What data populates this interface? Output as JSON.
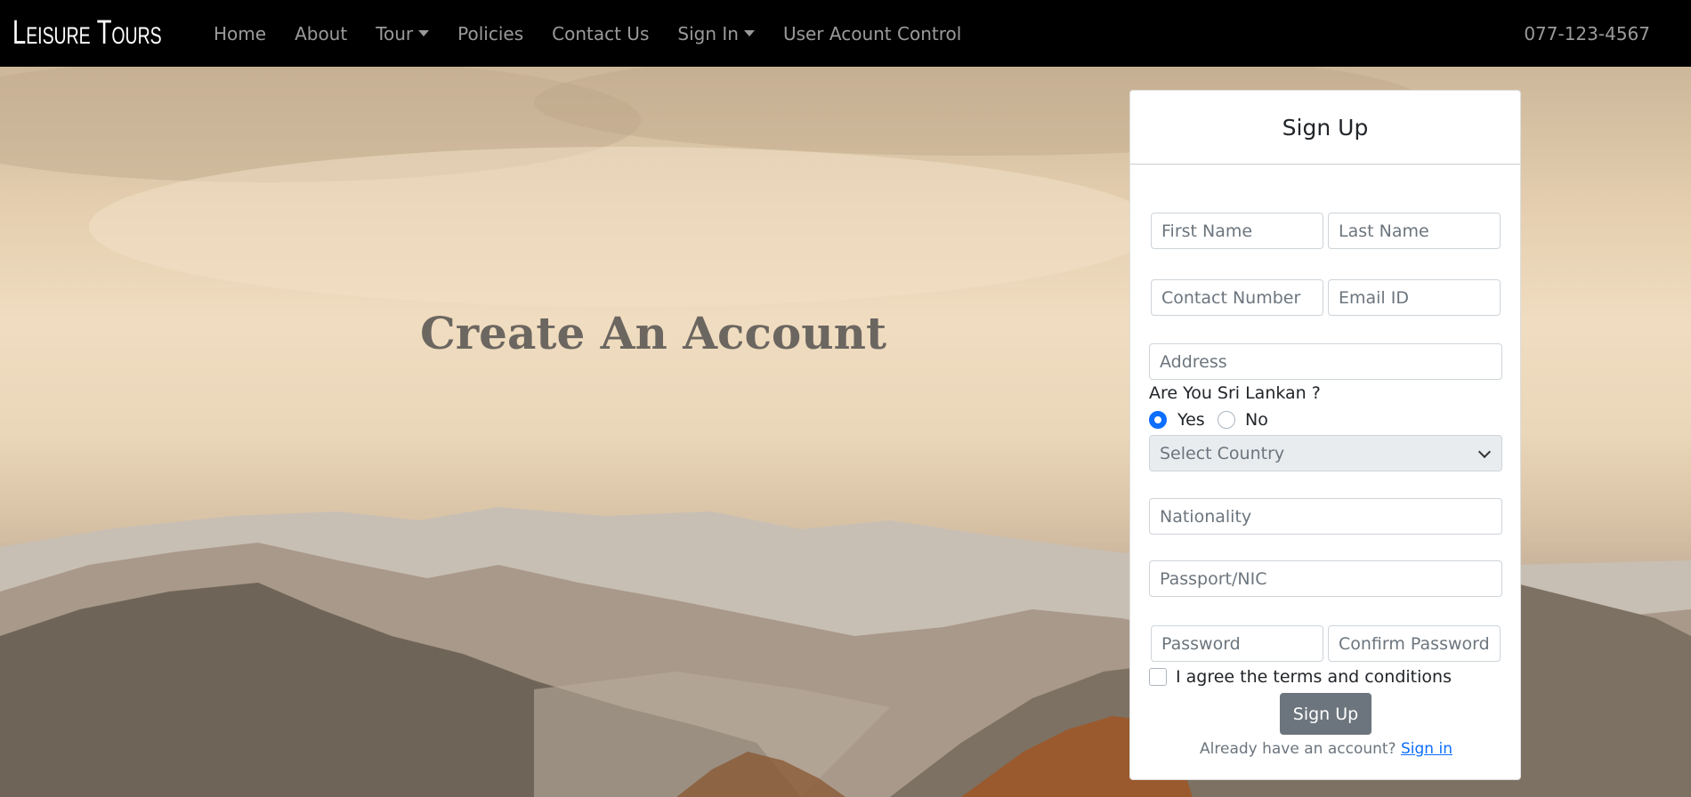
{
  "navbar": {
    "brand": "Leisure Tours",
    "items": [
      {
        "label": "Home",
        "dropdown": false
      },
      {
        "label": "About",
        "dropdown": false
      },
      {
        "label": "Tour",
        "dropdown": true
      },
      {
        "label": "Policies",
        "dropdown": false
      },
      {
        "label": "Contact Us",
        "dropdown": false
      },
      {
        "label": "Sign In",
        "dropdown": true
      },
      {
        "label": "User Acount Control",
        "dropdown": false
      }
    ],
    "phone": "077-123-4567"
  },
  "hero": {
    "title": "Create An Account"
  },
  "signup": {
    "title": "Sign Up",
    "first_name_placeholder": "First Name",
    "last_name_placeholder": "Last Name",
    "contact_placeholder": "Contact Number",
    "email_placeholder": "Email ID",
    "address_placeholder": "Address",
    "sri_lankan_question": "Are You Sri Lankan ?",
    "yes_label": "Yes",
    "no_label": "No",
    "selected_option": "Yes",
    "country_select": "Select Country",
    "nationality_placeholder": "Nationality",
    "passport_placeholder": "Passport/NIC",
    "password_placeholder": "Password",
    "confirm_password_placeholder": "Confirm Password",
    "terms_label": "I agree the terms and conditions",
    "submit_label": "Sign Up",
    "already_text": "Already have an account?",
    "signin_link": "Sign in"
  },
  "colors": {
    "navbar_bg": "#000000",
    "primary": "#0d6efd",
    "button_gray": "#6c757d"
  }
}
